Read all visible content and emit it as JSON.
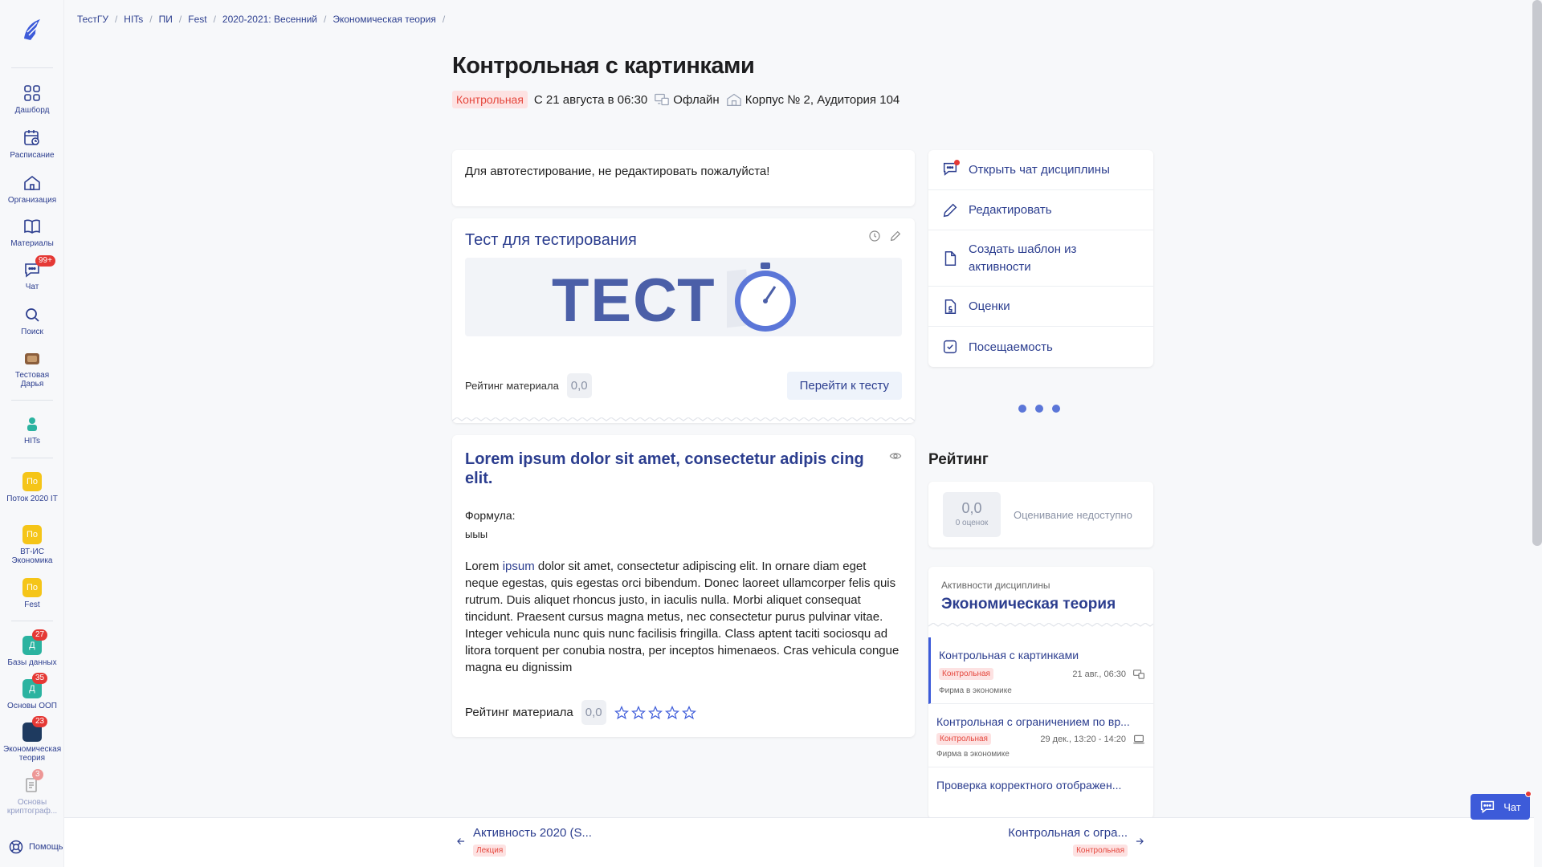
{
  "sidebar": {
    "items": [
      {
        "label": "Дашборд",
        "icon": "grid-icon"
      },
      {
        "label": "Расписание",
        "icon": "calendar-clock-icon"
      },
      {
        "label": "Организация",
        "icon": "home-icon"
      },
      {
        "label": "Материалы",
        "icon": "book-icon"
      },
      {
        "label": "Чат",
        "icon": "chat-icon",
        "badge": "99+"
      },
      {
        "label": "Поиск",
        "icon": "search-icon"
      },
      {
        "label": "Тестовая Дарья",
        "icon": "avatar"
      },
      {
        "label": "HITs",
        "icon": "org-logo"
      }
    ],
    "groups": [
      {
        "letter": "По",
        "label": "Поток 2020 IT"
      },
      {
        "letter": "По",
        "label": "ВТ-ИС Экономика"
      },
      {
        "letter": "По",
        "label": "Fest"
      }
    ],
    "courses": [
      {
        "letter": "Д",
        "label": "Базы данных",
        "badge": "27"
      },
      {
        "letter": "Д",
        "label": "Основы ООП",
        "badge": "35"
      },
      {
        "letter": "",
        "label": "Экономическая теория",
        "badge": "23"
      },
      {
        "letter": "",
        "label": "Основы криптограф...",
        "badge": "3"
      }
    ],
    "help_label": "Помощь"
  },
  "breadcrumb": [
    "ТестГУ",
    "HITs",
    "ПИ",
    "Fest",
    "2020-2021: Весенний",
    "Экономическая теория"
  ],
  "header": {
    "title": "Контрольная с картинками",
    "type_tag": "Контрольная",
    "date": "С 21 августа в 06:30",
    "mode": "Офлайн",
    "location": "Корпус № 2, Аудитория 104"
  },
  "description": "Для автотестирование, не редактировать пожалуйста!",
  "test_card": {
    "title": "Тест для тестирования",
    "banner_text": "ТЕСТ",
    "rating_label": "Рейтинг материала",
    "rating_value": "0,0",
    "button": "Перейти к тесту"
  },
  "lorem_card": {
    "title": "Lorem ipsum dolor sit amet, consectetur adipis cing elit.",
    "formula_label": "Формула:",
    "formula_value": "ыыы",
    "text_before": "Lorem ",
    "text_link": "ipsum",
    "text_after": " dolor sit amet, consectetur adipiscing elit. In ornare diam eget neque egestas, quis egestas orci bibendum. Donec laoreet ullamcorper felis quis rutrum. Duis aliquet rhoncus justo, in iaculis nulla. Morbi aliquet consequat tincidunt. Praesent cursus magna metus, nec consectetur purus pulvinar vitae. Integer vehicula nunc quis nunc facilisis fringilla. Class aptent taciti sociosqu ad litora torquent per conubia nostra, per inceptos himenaeos. Cras vehicula congue magna eu dignissim",
    "rating_label": "Рейтинг материала",
    "rating_value": "0,0",
    "stars": 0
  },
  "menu": [
    {
      "label": "Открыть чат дисциплины",
      "icon": "chat-icon"
    },
    {
      "label": "Редактировать",
      "icon": "pencil-icon"
    },
    {
      "label": "Создать шаблон из активности",
      "icon": "file-icon"
    },
    {
      "label": "Оценки",
      "icon": "grade-icon"
    },
    {
      "label": "Посещаемость",
      "icon": "check-square-icon"
    }
  ],
  "rating": {
    "heading": "Рейтинг",
    "value": "0,0",
    "count": "0 оценок",
    "status": "Оценивание недоступно"
  },
  "activities": {
    "subtitle": "Активности дисциплины",
    "title": "Экономическая теория",
    "items": [
      {
        "title": "Контрольная с картинками",
        "tag": "Контрольная",
        "time": "21 авг., 06:30",
        "sub": "Фирма в экономике",
        "active": true
      },
      {
        "title": "Контрольная с ограничением по вр...",
        "tag": "Контрольная",
        "time": "29 дек., 13:20 - 14:20",
        "sub": "Фирма в экономике",
        "active": false
      },
      {
        "title": "Проверка корректного отображен...",
        "tag": "",
        "time": "",
        "sub": "",
        "active": false
      }
    ]
  },
  "nav": {
    "prev_title": "Активность 2020 (S...",
    "prev_tag": "Лекция",
    "next_title": "Контрольная с огра...",
    "next_tag": "Контрольная"
  },
  "chat_button": "Чат",
  "colors": {
    "accent": "#2c3e8f",
    "primary": "#3d5bd9",
    "danger": "#e53935",
    "tag_bg": "#fde2e2"
  }
}
